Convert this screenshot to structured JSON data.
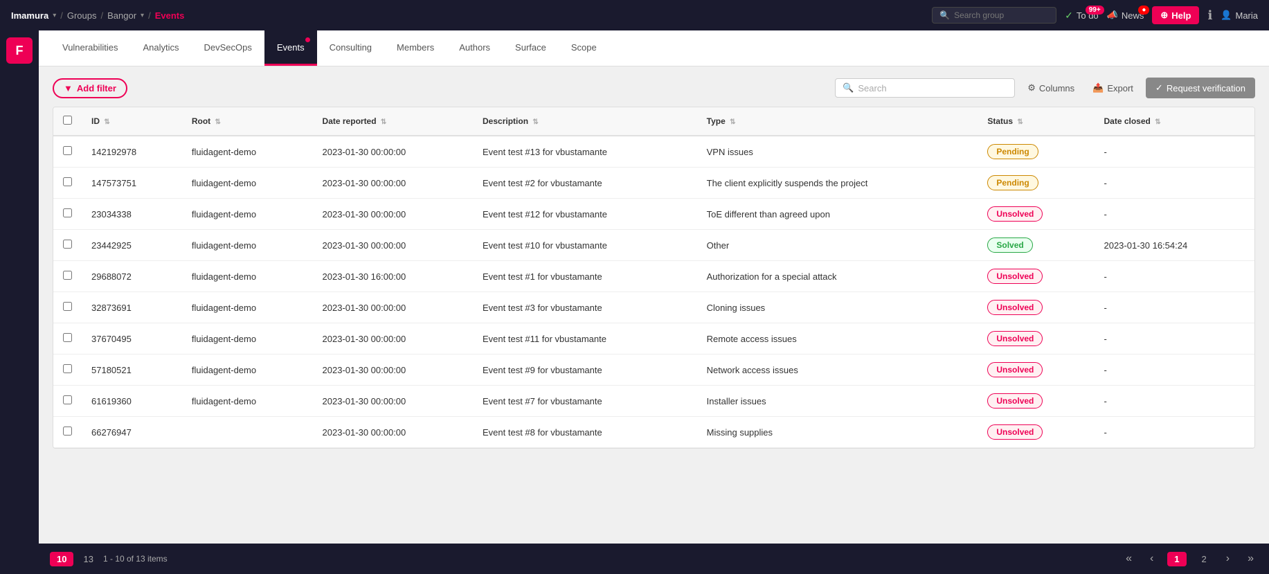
{
  "topnav": {
    "brand": "Imamura",
    "breadcrumbs": [
      "Groups",
      "Bangor",
      "Events"
    ],
    "search_group_placeholder": "Search group",
    "todo_label": "To do",
    "todo_badge": "99+",
    "news_label": "News",
    "help_label": "Help",
    "user_label": "Maria"
  },
  "tabs": [
    {
      "id": "vulnerabilities",
      "label": "Vulnerabilities",
      "active": false,
      "dot": false
    },
    {
      "id": "analytics",
      "label": "Analytics",
      "active": false,
      "dot": false
    },
    {
      "id": "devsecops",
      "label": "DevSecOps",
      "active": false,
      "dot": false
    },
    {
      "id": "events",
      "label": "Events",
      "active": true,
      "dot": true
    },
    {
      "id": "consulting",
      "label": "Consulting",
      "active": false,
      "dot": false
    },
    {
      "id": "members",
      "label": "Members",
      "active": false,
      "dot": false
    },
    {
      "id": "authors",
      "label": "Authors",
      "active": false,
      "dot": false
    },
    {
      "id": "surface",
      "label": "Surface",
      "active": false,
      "dot": false
    },
    {
      "id": "scope",
      "label": "Scope",
      "active": false,
      "dot": false
    }
  ],
  "toolbar": {
    "add_filter_label": "Add filter",
    "search_placeholder": "Search",
    "columns_label": "Columns",
    "export_label": "Export",
    "request_verify_label": "Request verification"
  },
  "table": {
    "headers": [
      "ID",
      "Root",
      "Date reported",
      "Description",
      "Type",
      "Status",
      "Date closed"
    ],
    "rows": [
      {
        "id": "142192978",
        "root": "fluidagent-demo",
        "date_reported": "2023-01-30 00:00:00",
        "description": "Event test #13 for vbustamante",
        "type": "VPN issues",
        "status": "Pending",
        "date_closed": "-"
      },
      {
        "id": "147573751",
        "root": "fluidagent-demo",
        "date_reported": "2023-01-30 00:00:00",
        "description": "Event test #2 for vbustamante",
        "type": "The client explicitly suspends the project",
        "status": "Pending",
        "date_closed": "-"
      },
      {
        "id": "23034338",
        "root": "fluidagent-demo",
        "date_reported": "2023-01-30 00:00:00",
        "description": "Event test #12 for vbustamante",
        "type": "ToE different than agreed upon",
        "status": "Unsolved",
        "date_closed": "-"
      },
      {
        "id": "23442925",
        "root": "fluidagent-demo",
        "date_reported": "2023-01-30 00:00:00",
        "description": "Event test #10 for vbustamante",
        "type": "Other",
        "status": "Solved",
        "date_closed": "2023-01-30 16:54:24"
      },
      {
        "id": "29688072",
        "root": "fluidagent-demo",
        "date_reported": "2023-01-30 16:00:00",
        "description": "Event test #1 for vbustamante",
        "type": "Authorization for a special attack",
        "status": "Unsolved",
        "date_closed": "-"
      },
      {
        "id": "32873691",
        "root": "fluidagent-demo",
        "date_reported": "2023-01-30 00:00:00",
        "description": "Event test #3 for vbustamante",
        "type": "Cloning issues",
        "status": "Unsolved",
        "date_closed": "-"
      },
      {
        "id": "37670495",
        "root": "fluidagent-demo",
        "date_reported": "2023-01-30 00:00:00",
        "description": "Event test #11 for vbustamante",
        "type": "Remote access issues",
        "status": "Unsolved",
        "date_closed": "-"
      },
      {
        "id": "57180521",
        "root": "fluidagent-demo",
        "date_reported": "2023-01-30 00:00:00",
        "description": "Event test #9 for vbustamante",
        "type": "Network access issues",
        "status": "Unsolved",
        "date_closed": "-"
      },
      {
        "id": "61619360",
        "root": "fluidagent-demo",
        "date_reported": "2023-01-30 00:00:00",
        "description": "Event test #7 for vbustamante",
        "type": "Installer issues",
        "status": "Unsolved",
        "date_closed": "-"
      },
      {
        "id": "66276947",
        "root": "",
        "date_reported": "2023-01-30 00:00:00",
        "description": "Event test #8 for vbustamante",
        "type": "Missing supplies",
        "status": "Unsolved",
        "date_closed": "-"
      }
    ]
  },
  "pagination": {
    "page_size_active": "10",
    "page_size_options": [
      "13"
    ],
    "info": "1 - 10 of 13 items",
    "current_page": "1",
    "total_pages": "2",
    "first_label": "«",
    "prev_label": "‹",
    "next_label": "›",
    "last_label": "»"
  },
  "colors": {
    "brand_red": "#e00050",
    "nav_dark": "#1a1a2e",
    "pending_color": "#cc8800",
    "solved_color": "#28a745",
    "unsolved_color": "#e00050"
  }
}
